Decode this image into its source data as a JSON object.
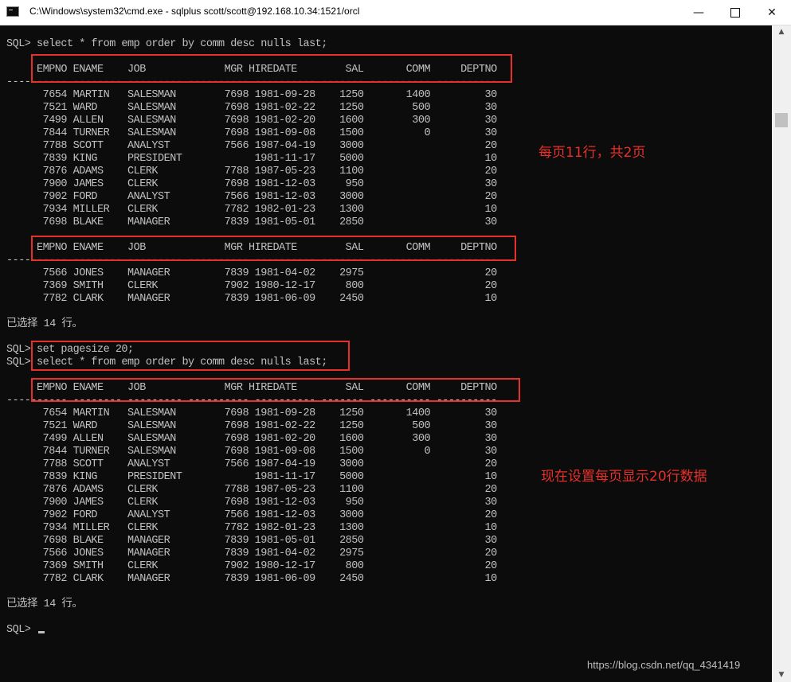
{
  "window": {
    "title": "C:\\Windows\\system32\\cmd.exe - sqlplus  scott/scott@192.168.10.34:1521/orcl",
    "minimize": "—",
    "close": "✕"
  },
  "console": {
    "lines": [
      "SQL> select * from emp order by comm desc nulls last;",
      "",
      "     EMPNO ENAME    JOB             MGR HIREDATE        SAL       COMM     DEPTNO",
      "---------- -------- --------- ---------- ---------- ------- ---------- ----------",
      "      7654 MARTIN   SALESMAN        7698 1981-09-28    1250       1400         30",
      "      7521 WARD     SALESMAN        7698 1981-02-22    1250        500         30",
      "      7499 ALLEN    SALESMAN        7698 1981-02-20    1600        300         30",
      "      7844 TURNER   SALESMAN        7698 1981-09-08    1500          0         30",
      "      7788 SCOTT    ANALYST         7566 1987-04-19    3000                    20",
      "      7839 KING     PRESIDENT            1981-11-17    5000                    10",
      "      7876 ADAMS    CLERK           7788 1987-05-23    1100                    20",
      "      7900 JAMES    CLERK           7698 1981-12-03     950                    30",
      "      7902 FORD     ANALYST         7566 1981-12-03    3000                    20",
      "      7934 MILLER   CLERK           7782 1982-01-23    1300                    10",
      "      7698 BLAKE    MANAGER         7839 1981-05-01    2850                    30",
      "",
      "     EMPNO ENAME    JOB             MGR HIREDATE        SAL       COMM     DEPTNO",
      "---------- -------- --------- ---------- ---------- ------- ---------- ----------",
      "      7566 JONES    MANAGER         7839 1981-04-02    2975                    20",
      "      7369 SMITH    CLERK           7902 1980-12-17     800                    20",
      "      7782 CLARK    MANAGER         7839 1981-06-09    2450                    10",
      "",
      "已选择 14 行。",
      "",
      "SQL> set pagesize 20;",
      "SQL> select * from emp order by comm desc nulls last;",
      "",
      "     EMPNO ENAME    JOB             MGR HIREDATE        SAL       COMM     DEPTNO",
      "---------- -------- --------- ---------- ---------- ------- ---------- ----------",
      "      7654 MARTIN   SALESMAN        7698 1981-09-28    1250       1400         30",
      "      7521 WARD     SALESMAN        7698 1981-02-22    1250        500         30",
      "      7499 ALLEN    SALESMAN        7698 1981-02-20    1600        300         30",
      "      7844 TURNER   SALESMAN        7698 1981-09-08    1500          0         30",
      "      7788 SCOTT    ANALYST         7566 1987-04-19    3000                    20",
      "      7839 KING     PRESIDENT            1981-11-17    5000                    10",
      "      7876 ADAMS    CLERK           7788 1987-05-23    1100                    20",
      "      7900 JAMES    CLERK           7698 1981-12-03     950                    30",
      "      7902 FORD     ANALYST         7566 1981-12-03    3000                    20",
      "      7934 MILLER   CLERK           7782 1982-01-23    1300                    10",
      "      7698 BLAKE    MANAGER         7839 1981-05-01    2850                    30",
      "      7566 JONES    MANAGER         7839 1981-04-02    2975                    20",
      "      7369 SMITH    CLERK           7902 1980-12-17     800                    20",
      "      7782 CLARK    MANAGER         7839 1981-06-09    2450                    10",
      "",
      "已选择 14 行。",
      "",
      "SQL> "
    ]
  },
  "annotations": {
    "note1": "每页11行，共2页",
    "note2": "现在设置每页显示20行数据",
    "color": "#e8302a"
  },
  "watermark": "https://blog.csdn.net/qq_4341419",
  "colors": {
    "console_bg": "#0c0c0c",
    "console_text": "#c0c0c0"
  }
}
